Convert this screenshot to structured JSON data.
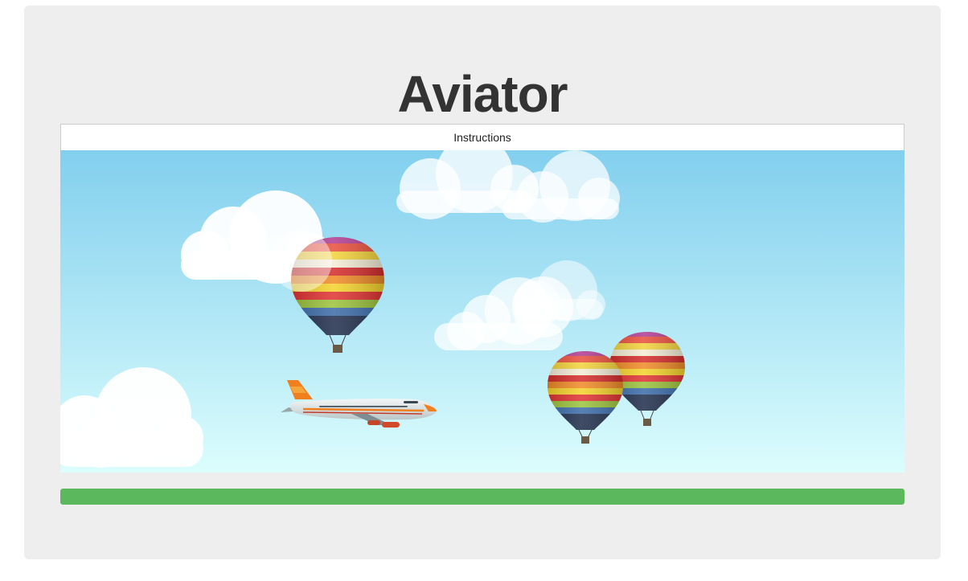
{
  "page": {
    "title": "Aviator"
  },
  "instructions": {
    "label": "Instructions"
  },
  "game": {
    "sky_top_color": "#82cfee",
    "sky_bottom_color": "#dcfdfd",
    "objects": {
      "player": "airplane",
      "obstacles": [
        "hot-air-balloon",
        "hot-air-balloon",
        "hot-air-balloon"
      ],
      "scenery": [
        "cloud",
        "cloud",
        "cloud",
        "cloud",
        "cloud"
      ]
    }
  },
  "progress": {
    "percent": 100,
    "color": "#5cb85c"
  }
}
